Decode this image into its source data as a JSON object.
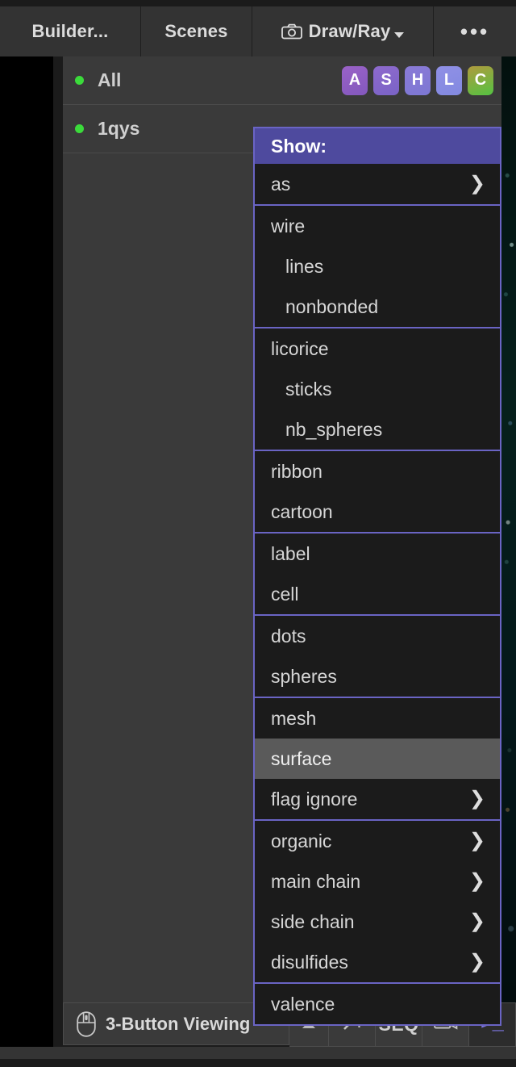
{
  "topbar": {
    "tabs": [
      {
        "label": "Builder...",
        "icon": null
      },
      {
        "label": "Scenes",
        "icon": null
      },
      {
        "label": "Draw/Ray",
        "icon": "camera-icon"
      },
      {
        "label": "•••",
        "icon": "more-icon"
      }
    ]
  },
  "object_list": {
    "rows": [
      {
        "name": "All",
        "status_color": "#3bdb3b",
        "buttons": [
          {
            "label": "A",
            "color": "#8b5fc0"
          },
          {
            "label": "S",
            "color": "#8266cb"
          },
          {
            "label": "H",
            "color": "#7e76d2"
          },
          {
            "label": "L",
            "color": "#8a8ce2"
          },
          {
            "label": "C",
            "color": "#6cc649"
          }
        ]
      },
      {
        "name": "1qys",
        "status_color": "#3bdb3b",
        "buttons": []
      }
    ]
  },
  "menu": {
    "title": "Show:",
    "groups": [
      {
        "items": [
          {
            "label": "as",
            "indent": false,
            "submenu": true,
            "highlight": false
          }
        ]
      },
      {
        "items": [
          {
            "label": "wire",
            "indent": false,
            "submenu": false,
            "highlight": false
          },
          {
            "label": "lines",
            "indent": true,
            "submenu": false,
            "highlight": false
          },
          {
            "label": "nonbonded",
            "indent": true,
            "submenu": false,
            "highlight": false
          }
        ]
      },
      {
        "items": [
          {
            "label": "licorice",
            "indent": false,
            "submenu": false,
            "highlight": false
          },
          {
            "label": "sticks",
            "indent": true,
            "submenu": false,
            "highlight": false
          },
          {
            "label": "nb_spheres",
            "indent": true,
            "submenu": false,
            "highlight": false
          }
        ]
      },
      {
        "items": [
          {
            "label": "ribbon",
            "indent": false,
            "submenu": false,
            "highlight": false
          },
          {
            "label": "cartoon",
            "indent": false,
            "submenu": false,
            "highlight": false
          }
        ]
      },
      {
        "items": [
          {
            "label": "label",
            "indent": false,
            "submenu": false,
            "highlight": false
          },
          {
            "label": "cell",
            "indent": false,
            "submenu": false,
            "highlight": false
          }
        ]
      },
      {
        "items": [
          {
            "label": "dots",
            "indent": false,
            "submenu": false,
            "highlight": false
          },
          {
            "label": "spheres",
            "indent": false,
            "submenu": false,
            "highlight": false
          }
        ]
      },
      {
        "items": [
          {
            "label": "mesh",
            "indent": false,
            "submenu": false,
            "highlight": false
          },
          {
            "label": "surface",
            "indent": false,
            "submenu": false,
            "highlight": true
          },
          {
            "label": "flag ignore",
            "indent": false,
            "submenu": true,
            "highlight": false
          }
        ]
      },
      {
        "items": [
          {
            "label": "organic",
            "indent": false,
            "submenu": true,
            "highlight": false
          },
          {
            "label": "main chain",
            "indent": false,
            "submenu": true,
            "highlight": false
          },
          {
            "label": "side chain",
            "indent": false,
            "submenu": true,
            "highlight": false
          },
          {
            "label": "disulfides",
            "indent": false,
            "submenu": true,
            "highlight": false
          }
        ]
      },
      {
        "items": [
          {
            "label": "valence",
            "indent": false,
            "submenu": false,
            "highlight": false
          }
        ]
      }
    ],
    "submenu_glyph": "❯",
    "accent_color": "#4e4a9e",
    "border_color": "#6a64c4",
    "highlight_color": "#5a5a5a"
  },
  "statusbar": {
    "mouse_mode": "3-Button Viewing",
    "mouse_icon": "mouse-icon",
    "buttons": [
      {
        "name": "caret-up-icon",
        "label": ""
      },
      {
        "name": "magic-wand-icon",
        "label": ""
      },
      {
        "name": "sequence-toggle",
        "label": "SEQ"
      },
      {
        "name": "movie-panel-icon",
        "label": ""
      },
      {
        "name": "command-prompt-icon",
        "label": ">_"
      }
    ]
  }
}
